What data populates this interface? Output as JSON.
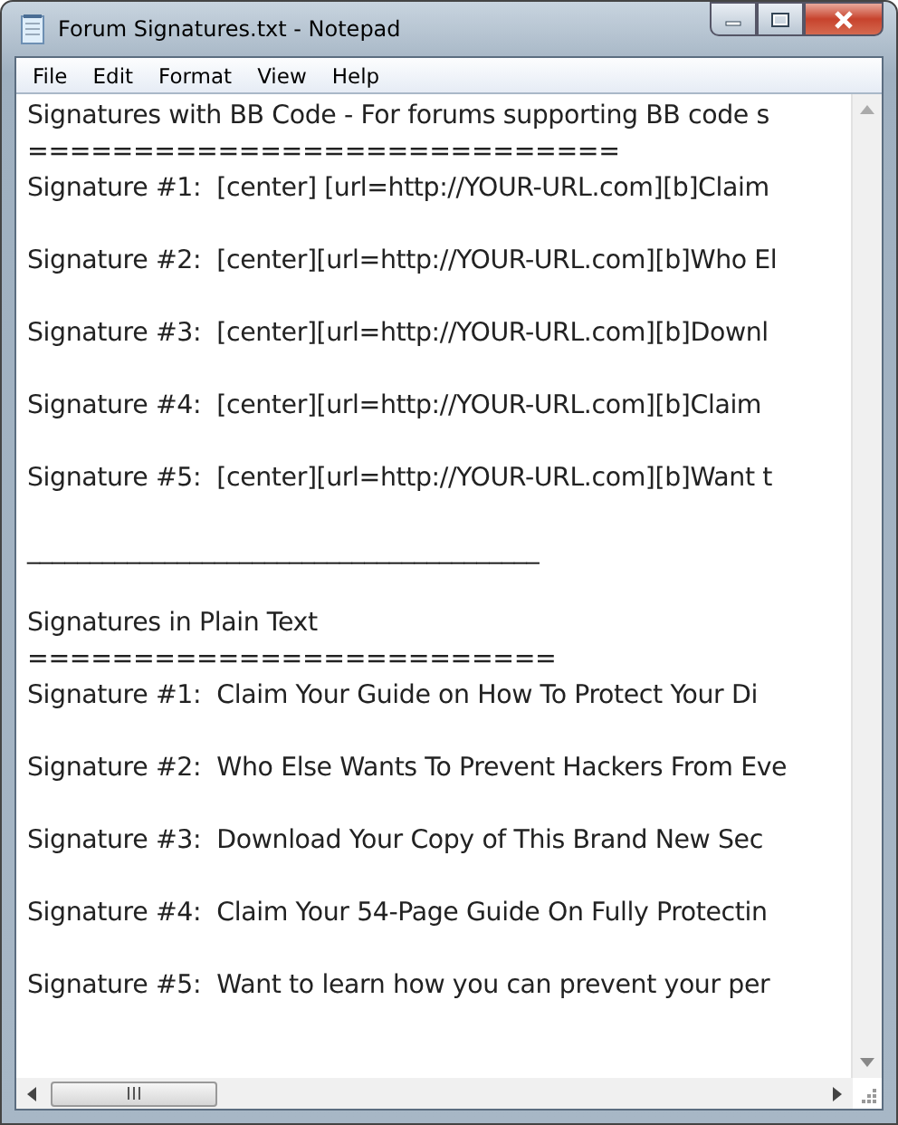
{
  "window": {
    "title": "Forum Signatures.txt - Notepad"
  },
  "menu": [
    "File",
    "Edit",
    "Format",
    "View",
    "Help"
  ],
  "paragraphs": [
    [
      "Signatures with BB Code - For forums supporting BB code s",
      "============================",
      "Signature #1:  [center] [url=http://YOUR-URL.com][b]Claim"
    ],
    [
      "Signature #2:  [center][url=http://YOUR-URL.com][b]Who El"
    ],
    [
      "Signature #3:  [center][url=http://YOUR-URL.com][b]Downl"
    ],
    [
      "Signature #4:  [center][url=http://YOUR-URL.com][b]Claim"
    ],
    [
      "Signature #5:  [center][url=http://YOUR-URL.com][b]Want t"
    ],
    [
      "_________________________________________"
    ],
    [
      "Signatures in Plain Text",
      "=========================",
      "Signature #1:  Claim Your Guide on How To Protect Your Di"
    ],
    [
      "Signature #2:  Who Else Wants To Prevent Hackers From Eve"
    ],
    [
      "Signature #3:  Download Your Copy of This Brand New Sec"
    ],
    [
      "Signature #4:  Claim Your 54-Page Guide On Fully Protectin"
    ],
    [
      "Signature #5:  Want to learn how you can prevent your per"
    ]
  ]
}
